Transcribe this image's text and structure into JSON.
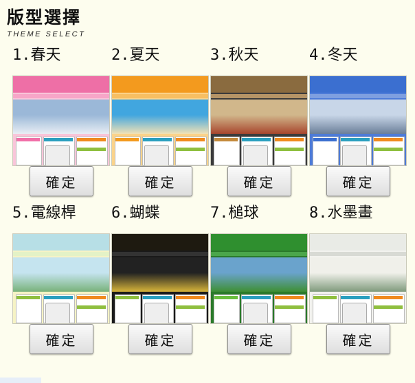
{
  "header": {
    "title": "版型選擇",
    "subtitle": "THEME SELECT"
  },
  "confirm_label": "確定",
  "themes": [
    {
      "label": "1.春天",
      "head": "#ee6fa6",
      "nav": "#f7a6c8",
      "img_top": "#9bb8d8",
      "img_bot": "#e8eef4",
      "body": "#f9c5d9",
      "accent": "#f16fa8"
    },
    {
      "label": "2.夏天",
      "head": "#f39a1e",
      "nav": "#f7bf63",
      "img_top": "#41a6df",
      "img_bot": "#f1e2b6",
      "body": "#fbd38a",
      "accent": "#f39a1e"
    },
    {
      "label": "3.秋天",
      "head": "#8a6b3f",
      "nav": "#b59466",
      "img_top": "#d1b78b",
      "img_bot": "#a8462d",
      "body": "#3b3b3b",
      "accent": "#c48a3b"
    },
    {
      "label": "4.冬天",
      "head": "#3b6fd0",
      "nav": "#7e9fe0",
      "img_top": "#c8d6e8",
      "img_bot": "#6b7f99",
      "body": "#4d7bd8",
      "accent": "#3b6fd0"
    },
    {
      "label": "5.電線桿",
      "head": "#b7dfe6",
      "nav": "#e4f2c6",
      "img_top": "#c5e4ef",
      "img_bot": "#78b27a",
      "body": "#f6f3c5",
      "accent": "#8fbf3f"
    },
    {
      "label": "6.蝴蝶",
      "head": "#1e1a10",
      "nav": "#333",
      "img_top": "#222",
      "img_bot": "#d7b43a",
      "body": "#1a1a1a",
      "accent": "#8fbf3f"
    },
    {
      "label": "7.槌球",
      "head": "#2f8f2f",
      "nav": "#4ba64b",
      "img_top": "#6aa3cc",
      "img_bot": "#3e8f34",
      "body": "#2a7a2a",
      "accent": "#6bbf3f"
    },
    {
      "label": "8.水墨畫",
      "head": "#e9ebe6",
      "nav": "#d8dad4",
      "img_top": "#f0f0ea",
      "img_bot": "#7f9a7c",
      "body": "#f2f2ee",
      "accent": "#8fbf3f"
    }
  ],
  "colors": {
    "background": "#fdfdee",
    "text": "#111111",
    "button_border": "#8a8a8a"
  }
}
